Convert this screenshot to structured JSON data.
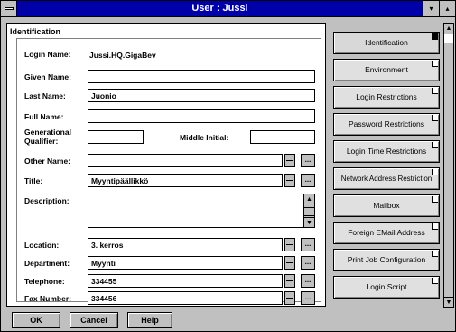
{
  "window": {
    "title": "User : Jussi",
    "minimize_glyph": "▾",
    "maximize_glyph": "▴"
  },
  "form": {
    "section_title": "Identification",
    "login_name": {
      "label": "Login Name:",
      "value": "Jussi.HQ.GigaBev"
    },
    "given_name": {
      "label": "Given Name:",
      "value": ""
    },
    "last_name": {
      "label": "Last Name:",
      "value": "Juonio"
    },
    "full_name": {
      "label": "Full Name:",
      "value": ""
    },
    "generational_qualifier": {
      "label_line1": "Generational",
      "label_line2": "Qualifier:",
      "value": ""
    },
    "middle_initial": {
      "label": "Middle Initial:",
      "value": ""
    },
    "other_name": {
      "label": "Other Name:",
      "value": ""
    },
    "title": {
      "label": "Title:",
      "value": "Myyntipäällikkö"
    },
    "description": {
      "label": "Description:",
      "value": ""
    },
    "location": {
      "label": "Location:",
      "value": "3. kerros"
    },
    "department": {
      "label": "Department:",
      "value": "Myynti"
    },
    "telephone": {
      "label": "Telephone:",
      "value": "334455"
    },
    "fax_number": {
      "label": "Fax Number:",
      "value": "334456"
    },
    "browse_label": "..."
  },
  "buttons": {
    "ok": "OK",
    "cancel": "Cancel",
    "help": "Help"
  },
  "tabs": [
    {
      "label": "Identification",
      "active": true
    },
    {
      "label": "Environment"
    },
    {
      "label": "Login Restrictions"
    },
    {
      "label": "Password Restrictions"
    },
    {
      "label": "Login Time Restrictions"
    },
    {
      "label": "Network Address Restriction"
    },
    {
      "label": "Mailbox"
    },
    {
      "label": "Foreign EMail Address"
    },
    {
      "label": "Print Job Configuration"
    },
    {
      "label": "Login Script"
    }
  ],
  "scroll_glyphs": {
    "up": "▲",
    "down": "▼"
  }
}
